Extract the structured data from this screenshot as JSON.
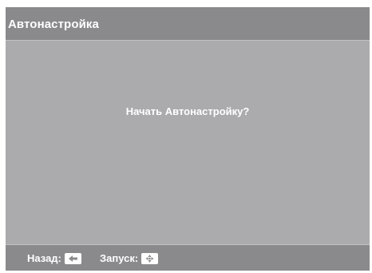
{
  "window": {
    "title": "Автонастройка"
  },
  "main": {
    "prompt": "Начать Автонастройку?"
  },
  "footer": {
    "back_label": "Назад:",
    "back_icon": "back-arrow-key-icon",
    "start_label": "Запуск:",
    "start_icon": "enter-key-icon"
  },
  "colors": {
    "bar": "#8a8a8d",
    "background": "#ababae",
    "text": "#ffffff"
  }
}
